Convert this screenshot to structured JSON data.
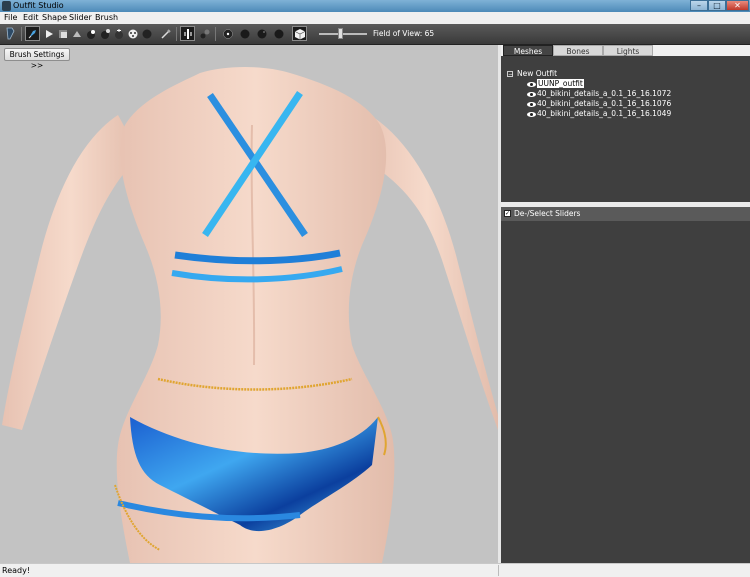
{
  "window": {
    "title": "Outfit Studio",
    "min": "–",
    "max": "□",
    "close": "✕"
  },
  "menu": {
    "file": "File",
    "edit": "Edit",
    "shape": "Shape",
    "slider": "Slider",
    "brush": "Brush"
  },
  "toolbar": {
    "icons": [
      "select-icon",
      "brush-icon",
      "smooth-icon",
      "inflate-icon",
      "deflate-icon",
      "move-icon",
      "weight-icon",
      "color-icon",
      "alpha-icon",
      "mirror-icon",
      "transform-icon",
      "pivot-icon",
      "wireframe-icon",
      "lighting-icon",
      "texture-icon",
      "vertex-icon",
      "cube-view-icon"
    ],
    "fov_label": "Field of View: 65",
    "fov_value": 65
  },
  "viewport": {
    "brush_settings_label": "Brush Settings >>"
  },
  "panel": {
    "tabs": [
      "Meshes",
      "Bones",
      "Lights"
    ],
    "active_tab": "Meshes",
    "tree": {
      "root": "New Outfit",
      "expander": "−",
      "meshes": [
        "UUNP_outfit",
        "40_bikini_details_a_0.1_16_16.1072",
        "40_bikini_details_a_0.1_16_16.1076",
        "40_bikini_details_a_0.1_16_16.1049"
      ]
    },
    "sliders_header": "De-/Select Sliders",
    "sliders_checkbox": "✓"
  },
  "status": {
    "text": "Ready!"
  },
  "colors": {
    "viewport_bg": "#c3c3c3",
    "panel_dark": "#3f3f3f",
    "bikini_blue": "#1e6fd8"
  }
}
